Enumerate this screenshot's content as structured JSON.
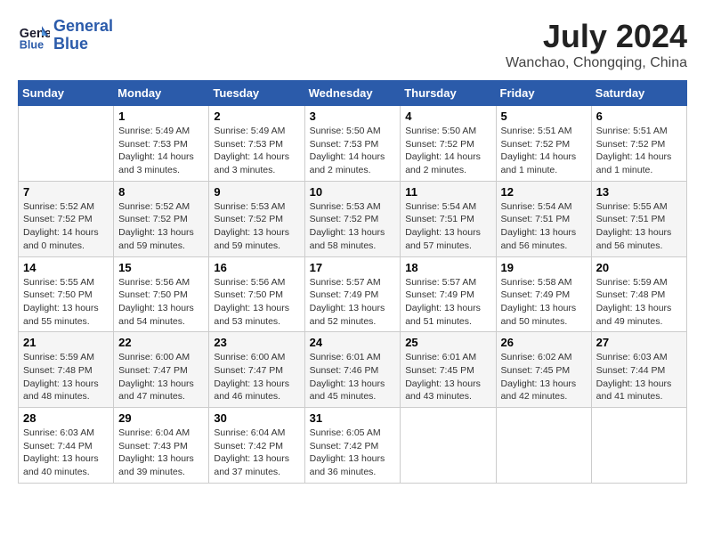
{
  "header": {
    "logo_line1": "General",
    "logo_line2": "Blue",
    "month": "July 2024",
    "location": "Wanchao, Chongqing, China"
  },
  "weekdays": [
    "Sunday",
    "Monday",
    "Tuesday",
    "Wednesday",
    "Thursday",
    "Friday",
    "Saturday"
  ],
  "weeks": [
    [
      {
        "day": "",
        "info": ""
      },
      {
        "day": "1",
        "info": "Sunrise: 5:49 AM\nSunset: 7:53 PM\nDaylight: 14 hours\nand 3 minutes."
      },
      {
        "day": "2",
        "info": "Sunrise: 5:49 AM\nSunset: 7:53 PM\nDaylight: 14 hours\nand 3 minutes."
      },
      {
        "day": "3",
        "info": "Sunrise: 5:50 AM\nSunset: 7:53 PM\nDaylight: 14 hours\nand 2 minutes."
      },
      {
        "day": "4",
        "info": "Sunrise: 5:50 AM\nSunset: 7:52 PM\nDaylight: 14 hours\nand 2 minutes."
      },
      {
        "day": "5",
        "info": "Sunrise: 5:51 AM\nSunset: 7:52 PM\nDaylight: 14 hours\nand 1 minute."
      },
      {
        "day": "6",
        "info": "Sunrise: 5:51 AM\nSunset: 7:52 PM\nDaylight: 14 hours\nand 1 minute."
      }
    ],
    [
      {
        "day": "7",
        "info": "Sunrise: 5:52 AM\nSunset: 7:52 PM\nDaylight: 14 hours\nand 0 minutes."
      },
      {
        "day": "8",
        "info": "Sunrise: 5:52 AM\nSunset: 7:52 PM\nDaylight: 13 hours\nand 59 minutes."
      },
      {
        "day": "9",
        "info": "Sunrise: 5:53 AM\nSunset: 7:52 PM\nDaylight: 13 hours\nand 59 minutes."
      },
      {
        "day": "10",
        "info": "Sunrise: 5:53 AM\nSunset: 7:52 PM\nDaylight: 13 hours\nand 58 minutes."
      },
      {
        "day": "11",
        "info": "Sunrise: 5:54 AM\nSunset: 7:51 PM\nDaylight: 13 hours\nand 57 minutes."
      },
      {
        "day": "12",
        "info": "Sunrise: 5:54 AM\nSunset: 7:51 PM\nDaylight: 13 hours\nand 56 minutes."
      },
      {
        "day": "13",
        "info": "Sunrise: 5:55 AM\nSunset: 7:51 PM\nDaylight: 13 hours\nand 56 minutes."
      }
    ],
    [
      {
        "day": "14",
        "info": "Sunrise: 5:55 AM\nSunset: 7:50 PM\nDaylight: 13 hours\nand 55 minutes."
      },
      {
        "day": "15",
        "info": "Sunrise: 5:56 AM\nSunset: 7:50 PM\nDaylight: 13 hours\nand 54 minutes."
      },
      {
        "day": "16",
        "info": "Sunrise: 5:56 AM\nSunset: 7:50 PM\nDaylight: 13 hours\nand 53 minutes."
      },
      {
        "day": "17",
        "info": "Sunrise: 5:57 AM\nSunset: 7:49 PM\nDaylight: 13 hours\nand 52 minutes."
      },
      {
        "day": "18",
        "info": "Sunrise: 5:57 AM\nSunset: 7:49 PM\nDaylight: 13 hours\nand 51 minutes."
      },
      {
        "day": "19",
        "info": "Sunrise: 5:58 AM\nSunset: 7:49 PM\nDaylight: 13 hours\nand 50 minutes."
      },
      {
        "day": "20",
        "info": "Sunrise: 5:59 AM\nSunset: 7:48 PM\nDaylight: 13 hours\nand 49 minutes."
      }
    ],
    [
      {
        "day": "21",
        "info": "Sunrise: 5:59 AM\nSunset: 7:48 PM\nDaylight: 13 hours\nand 48 minutes."
      },
      {
        "day": "22",
        "info": "Sunrise: 6:00 AM\nSunset: 7:47 PM\nDaylight: 13 hours\nand 47 minutes."
      },
      {
        "day": "23",
        "info": "Sunrise: 6:00 AM\nSunset: 7:47 PM\nDaylight: 13 hours\nand 46 minutes."
      },
      {
        "day": "24",
        "info": "Sunrise: 6:01 AM\nSunset: 7:46 PM\nDaylight: 13 hours\nand 45 minutes."
      },
      {
        "day": "25",
        "info": "Sunrise: 6:01 AM\nSunset: 7:45 PM\nDaylight: 13 hours\nand 43 minutes."
      },
      {
        "day": "26",
        "info": "Sunrise: 6:02 AM\nSunset: 7:45 PM\nDaylight: 13 hours\nand 42 minutes."
      },
      {
        "day": "27",
        "info": "Sunrise: 6:03 AM\nSunset: 7:44 PM\nDaylight: 13 hours\nand 41 minutes."
      }
    ],
    [
      {
        "day": "28",
        "info": "Sunrise: 6:03 AM\nSunset: 7:44 PM\nDaylight: 13 hours\nand 40 minutes."
      },
      {
        "day": "29",
        "info": "Sunrise: 6:04 AM\nSunset: 7:43 PM\nDaylight: 13 hours\nand 39 minutes."
      },
      {
        "day": "30",
        "info": "Sunrise: 6:04 AM\nSunset: 7:42 PM\nDaylight: 13 hours\nand 37 minutes."
      },
      {
        "day": "31",
        "info": "Sunrise: 6:05 AM\nSunset: 7:42 PM\nDaylight: 13 hours\nand 36 minutes."
      },
      {
        "day": "",
        "info": ""
      },
      {
        "day": "",
        "info": ""
      },
      {
        "day": "",
        "info": ""
      }
    ]
  ]
}
